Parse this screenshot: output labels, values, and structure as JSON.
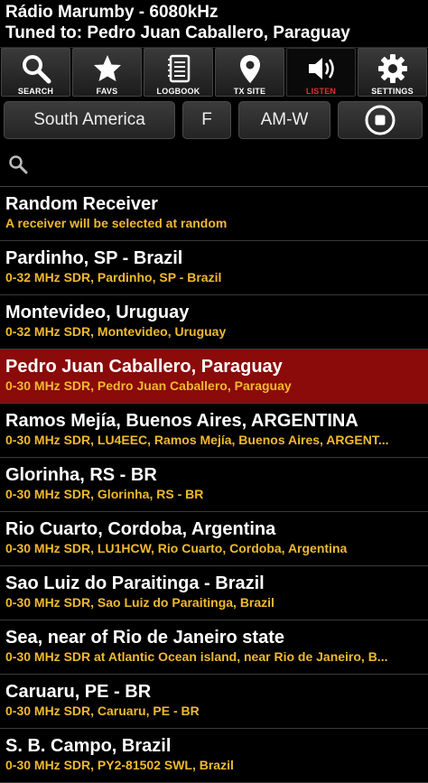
{
  "header": {
    "station": "Rádio Marumby - 6080kHz",
    "tuned": "Tuned to: Pedro Juan Caballero, Paraguay"
  },
  "toolbar": [
    {
      "label": "SEARCH",
      "icon": "search-icon"
    },
    {
      "label": "FAVS",
      "icon": "star-icon"
    },
    {
      "label": "LOGBOOK",
      "icon": "notebook-icon"
    },
    {
      "label": "TX SITE",
      "icon": "map-pin-icon"
    },
    {
      "label": "LISTEN",
      "icon": "speaker-icon",
      "active": true
    },
    {
      "label": "SETTINGS",
      "icon": "gear-icon"
    }
  ],
  "filters": {
    "region": "South America",
    "freq": "F",
    "mode": "AM-W"
  },
  "search": {
    "value": ""
  },
  "receivers": [
    {
      "title": "Random Receiver",
      "sub": "A receiver will be selected at random"
    },
    {
      "title": "Pardinho, SP - Brazil",
      "sub": "0-32 MHz SDR, Pardinho, SP - Brazil"
    },
    {
      "title": "Montevideo, Uruguay",
      "sub": "0-32 MHz SDR, Montevideo, Uruguay"
    },
    {
      "title": "Pedro Juan Caballero, Paraguay",
      "sub": "0-30 MHz SDR, Pedro Juan Caballero, Paraguay",
      "selected": true
    },
    {
      "title": "Ramos Mejía, Buenos Aires, ARGENTINA",
      "sub": "0-30 MHz SDR, LU4EEC, Ramos Mejía, Buenos Aires, ARGENT..."
    },
    {
      "title": "Glorinha, RS - BR",
      "sub": "0-30 MHz SDR, Glorinha, RS - BR"
    },
    {
      "title": "Rio Cuarto, Cordoba, Argentina",
      "sub": "0-30 MHz SDR, LU1HCW, Rio Cuarto, Cordoba, Argentina"
    },
    {
      "title": "Sao Luiz do Paraitinga - Brazil",
      "sub": "0-30 MHz SDR, Sao Luiz do Paraitinga, Brazil"
    },
    {
      "title": "Sea, near of Rio de Janeiro state",
      "sub": "0-30 MHz SDR at Atlantic Ocean island, near Rio de Janeiro, B..."
    },
    {
      "title": "Caruaru, PE - BR",
      "sub": "0-30 MHz SDR, Caruaru, PE - BR"
    },
    {
      "title": "S. B. Campo, Brazil",
      "sub": "0-30 MHz SDR, PY2-81502 SWL, Brazil"
    }
  ],
  "colors": {
    "accent_sub": "#f0b92f",
    "selected_bg": "#8b0a0a",
    "active_label": "#e03030"
  }
}
